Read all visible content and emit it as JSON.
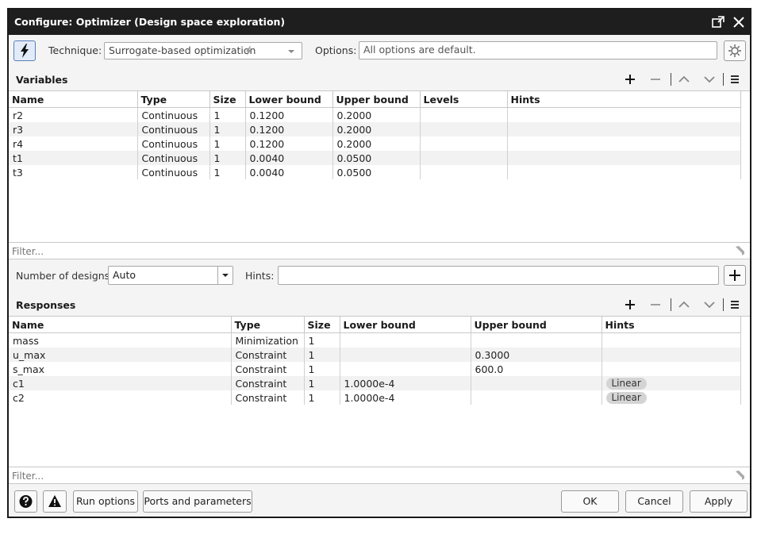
{
  "window": {
    "title": "Configure: Optimizer (Design space exploration)"
  },
  "toolbar": {
    "technique_label": "Technique:",
    "technique_value": "Surrogate-based optimization",
    "options_label": "Options:",
    "options_value": "All options are default."
  },
  "variables": {
    "title": "Variables",
    "columns": [
      "Name",
      "Type",
      "Size",
      "Lower bound",
      "Upper bound",
      "Levels",
      "Hints"
    ],
    "rows": [
      [
        "r2",
        "Continuous",
        "1",
        "0.1200",
        "0.2000",
        "",
        ""
      ],
      [
        "r3",
        "Continuous",
        "1",
        "0.1200",
        "0.2000",
        "",
        ""
      ],
      [
        "r4",
        "Continuous",
        "1",
        "0.1200",
        "0.2000",
        "",
        ""
      ],
      [
        "t1",
        "Continuous",
        "1",
        "0.0040",
        "0.0500",
        "",
        ""
      ],
      [
        "t3",
        "Continuous",
        "1",
        "0.0040",
        "0.0500",
        "",
        ""
      ]
    ],
    "filter_placeholder": "Filter..."
  },
  "designs": {
    "label": "Number of designs:",
    "value": "Auto",
    "hints_label": "Hints:",
    "hints_value": ""
  },
  "responses": {
    "title": "Responses",
    "columns": [
      "Name",
      "Type",
      "Size",
      "Lower bound",
      "Upper bound",
      "Hints"
    ],
    "rows": [
      [
        "mass",
        "Minimization",
        "1",
        "",
        "",
        ""
      ],
      [
        "u_max",
        "Constraint",
        "1",
        "",
        "0.3000",
        ""
      ],
      [
        "s_max",
        "Constraint",
        "1",
        "",
        "600.0",
        ""
      ],
      [
        "c1",
        "Constraint",
        "1",
        "1.0000e-4",
        "",
        "Linear"
      ],
      [
        "c2",
        "Constraint",
        "1",
        "1.0000e-4",
        "",
        "Linear"
      ]
    ],
    "filter_placeholder": "Filter..."
  },
  "footer": {
    "run_options": "Run options",
    "ports_parameters": "Ports and parameters",
    "ok": "OK",
    "cancel": "Cancel",
    "apply": "Apply"
  },
  "colors": {
    "titlebar": "#1e1e1e",
    "panel": "#f4f4f4",
    "alt_row": "#f2f2f2",
    "tag": "#d4d4d4"
  },
  "icons": {
    "technique": "lightning-icon",
    "options": "gear-icon",
    "add": "plus-icon",
    "remove": "minus-icon",
    "up": "chevron-up-icon",
    "down": "chevron-down-icon",
    "menu": "menu-icon",
    "filter": "filter-icon",
    "help": "help-icon",
    "warning": "warning-icon"
  }
}
